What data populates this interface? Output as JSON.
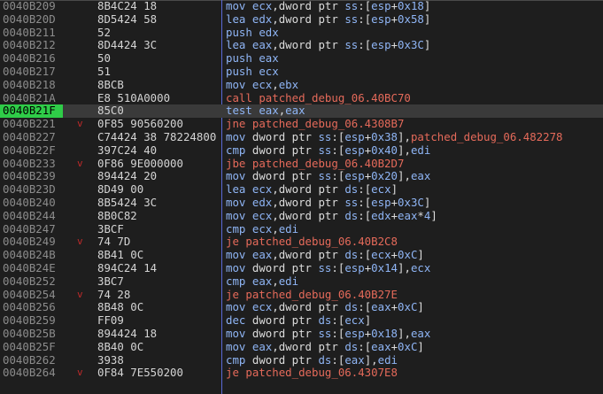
{
  "colors": {
    "background": "#1e1e1e",
    "current_address_bg": "#2fcc48",
    "separator": "#5a6ad8",
    "branch_mnemonic": "#e56a5a",
    "mnemonic": "#8fb5f5"
  },
  "rows": [
    {
      "addr": "0040B209",
      "bytes": "8B4C24 18",
      "mnem": "mov",
      "ops": [
        [
          "reg",
          "ecx"
        ],
        [
          "punc",
          ","
        ],
        [
          "ptr",
          "dword ptr "
        ],
        [
          "seg",
          "ss"
        ],
        [
          "punc",
          ":["
        ],
        [
          "reg",
          "esp"
        ],
        [
          "punc",
          "+"
        ],
        [
          "num",
          "0x18"
        ],
        [
          "punc",
          "]"
        ]
      ]
    },
    {
      "addr": "0040B20D",
      "bytes": "8D5424 58",
      "mnem": "lea",
      "ops": [
        [
          "reg",
          "edx"
        ],
        [
          "punc",
          ","
        ],
        [
          "ptr",
          "dword ptr "
        ],
        [
          "seg",
          "ss"
        ],
        [
          "punc",
          ":["
        ],
        [
          "reg",
          "esp"
        ],
        [
          "punc",
          "+"
        ],
        [
          "num",
          "0x58"
        ],
        [
          "punc",
          "]"
        ]
      ]
    },
    {
      "addr": "0040B211",
      "bytes": "52",
      "mnem": "push",
      "ops": [
        [
          "reg",
          "edx"
        ]
      ]
    },
    {
      "addr": "0040B212",
      "bytes": "8D4424 3C",
      "mnem": "lea",
      "ops": [
        [
          "reg",
          "eax"
        ],
        [
          "punc",
          ","
        ],
        [
          "ptr",
          "dword ptr "
        ],
        [
          "seg",
          "ss"
        ],
        [
          "punc",
          ":["
        ],
        [
          "reg",
          "esp"
        ],
        [
          "punc",
          "+"
        ],
        [
          "num",
          "0x3C"
        ],
        [
          "punc",
          "]"
        ]
      ]
    },
    {
      "addr": "0040B216",
      "bytes": "50",
      "mnem": "push",
      "ops": [
        [
          "reg",
          "eax"
        ]
      ]
    },
    {
      "addr": "0040B217",
      "bytes": "51",
      "mnem": "push",
      "ops": [
        [
          "reg",
          "ecx"
        ]
      ]
    },
    {
      "addr": "0040B218",
      "bytes": "8BCB",
      "mnem": "mov",
      "ops": [
        [
          "reg",
          "ecx"
        ],
        [
          "punc",
          ","
        ],
        [
          "reg",
          "ebx"
        ]
      ]
    },
    {
      "addr": "0040B21A",
      "bytes": "E8 510A0000",
      "mnem": "call",
      "jump": true,
      "ops": [
        [
          "sym",
          "patched_debug_06.40BC70"
        ]
      ]
    },
    {
      "addr": "0040B21F",
      "bytes": "85C0",
      "mnem": "test",
      "current": true,
      "ops": [
        [
          "reg",
          "eax"
        ],
        [
          "punc",
          ","
        ],
        [
          "reg",
          "eax"
        ]
      ]
    },
    {
      "addr": "0040B221",
      "bytes": "0F85 90560200",
      "mark": "v",
      "mnem": "jne",
      "jump": true,
      "ops": [
        [
          "sym",
          "patched_debug_06.4308B7"
        ]
      ]
    },
    {
      "addr": "0040B227",
      "bytes": "C74424 38 78224800",
      "mnem": "mov",
      "ops": [
        [
          "ptr",
          "dword ptr "
        ],
        [
          "seg",
          "ss"
        ],
        [
          "punc",
          ":["
        ],
        [
          "reg",
          "esp"
        ],
        [
          "punc",
          "+"
        ],
        [
          "num",
          "0x38"
        ],
        [
          "punc",
          "],"
        ],
        [
          "sym",
          "patched_debug_06.482278"
        ]
      ]
    },
    {
      "addr": "0040B22F",
      "bytes": "397C24 40",
      "mnem": "cmp",
      "ops": [
        [
          "ptr",
          "dword ptr "
        ],
        [
          "seg",
          "ss"
        ],
        [
          "punc",
          ":["
        ],
        [
          "reg",
          "esp"
        ],
        [
          "punc",
          "+"
        ],
        [
          "num",
          "0x40"
        ],
        [
          "punc",
          "],"
        ],
        [
          "reg",
          "edi"
        ]
      ]
    },
    {
      "addr": "0040B233",
      "bytes": "0F86 9E000000",
      "mark": "v",
      "mnem": "jbe",
      "jump": true,
      "ops": [
        [
          "sym",
          "patched_debug_06.40B2D7"
        ]
      ]
    },
    {
      "addr": "0040B239",
      "bytes": "894424 20",
      "mnem": "mov",
      "ops": [
        [
          "ptr",
          "dword ptr "
        ],
        [
          "seg",
          "ss"
        ],
        [
          "punc",
          ":["
        ],
        [
          "reg",
          "esp"
        ],
        [
          "punc",
          "+"
        ],
        [
          "num",
          "0x20"
        ],
        [
          "punc",
          "],"
        ],
        [
          "reg",
          "eax"
        ]
      ]
    },
    {
      "addr": "0040B23D",
      "bytes": "8D49 00",
      "mnem": "lea",
      "ops": [
        [
          "reg",
          "ecx"
        ],
        [
          "punc",
          ","
        ],
        [
          "ptr",
          "dword ptr "
        ],
        [
          "seg",
          "ds"
        ],
        [
          "punc",
          ":["
        ],
        [
          "reg",
          "ecx"
        ],
        [
          "punc",
          "]"
        ]
      ]
    },
    {
      "addr": "0040B240",
      "bytes": "8B5424 3C",
      "mnem": "mov",
      "ops": [
        [
          "reg",
          "edx"
        ],
        [
          "punc",
          ","
        ],
        [
          "ptr",
          "dword ptr "
        ],
        [
          "seg",
          "ss"
        ],
        [
          "punc",
          ":["
        ],
        [
          "reg",
          "esp"
        ],
        [
          "punc",
          "+"
        ],
        [
          "num",
          "0x3C"
        ],
        [
          "punc",
          "]"
        ]
      ]
    },
    {
      "addr": "0040B244",
      "bytes": "8B0C82",
      "mnem": "mov",
      "ops": [
        [
          "reg",
          "ecx"
        ],
        [
          "punc",
          ","
        ],
        [
          "ptr",
          "dword ptr "
        ],
        [
          "seg",
          "ds"
        ],
        [
          "punc",
          ":["
        ],
        [
          "reg",
          "edx"
        ],
        [
          "punc",
          "+"
        ],
        [
          "reg",
          "eax"
        ],
        [
          "punc",
          "*"
        ],
        [
          "num",
          "4"
        ],
        [
          "punc",
          "]"
        ]
      ]
    },
    {
      "addr": "0040B247",
      "bytes": "3BCF",
      "mnem": "cmp",
      "ops": [
        [
          "reg",
          "ecx"
        ],
        [
          "punc",
          ","
        ],
        [
          "reg",
          "edi"
        ]
      ]
    },
    {
      "addr": "0040B249",
      "bytes": "74 7D",
      "mark": "v",
      "mnem": "je",
      "jump": true,
      "ops": [
        [
          "sym",
          "patched_debug_06.40B2C8"
        ]
      ]
    },
    {
      "addr": "0040B24B",
      "bytes": "8B41 0C",
      "mnem": "mov",
      "ops": [
        [
          "reg",
          "eax"
        ],
        [
          "punc",
          ","
        ],
        [
          "ptr",
          "dword ptr "
        ],
        [
          "seg",
          "ds"
        ],
        [
          "punc",
          ":["
        ],
        [
          "reg",
          "ecx"
        ],
        [
          "punc",
          "+"
        ],
        [
          "num",
          "0xC"
        ],
        [
          "punc",
          "]"
        ]
      ]
    },
    {
      "addr": "0040B24E",
      "bytes": "894C24 14",
      "mnem": "mov",
      "ops": [
        [
          "ptr",
          "dword ptr "
        ],
        [
          "seg",
          "ss"
        ],
        [
          "punc",
          ":["
        ],
        [
          "reg",
          "esp"
        ],
        [
          "punc",
          "+"
        ],
        [
          "num",
          "0x14"
        ],
        [
          "punc",
          "],"
        ],
        [
          "reg",
          "ecx"
        ]
      ]
    },
    {
      "addr": "0040B252",
      "bytes": "3BC7",
      "mnem": "cmp",
      "ops": [
        [
          "reg",
          "eax"
        ],
        [
          "punc",
          ","
        ],
        [
          "reg",
          "edi"
        ]
      ]
    },
    {
      "addr": "0040B254",
      "bytes": "74 28",
      "mark": "v",
      "mnem": "je",
      "jump": true,
      "ops": [
        [
          "sym",
          "patched_debug_06.40B27E"
        ]
      ]
    },
    {
      "addr": "0040B256",
      "bytes": "8B48 0C",
      "mnem": "mov",
      "ops": [
        [
          "reg",
          "ecx"
        ],
        [
          "punc",
          ","
        ],
        [
          "ptr",
          "dword ptr "
        ],
        [
          "seg",
          "ds"
        ],
        [
          "punc",
          ":["
        ],
        [
          "reg",
          "eax"
        ],
        [
          "punc",
          "+"
        ],
        [
          "num",
          "0xC"
        ],
        [
          "punc",
          "]"
        ]
      ]
    },
    {
      "addr": "0040B259",
      "bytes": "FF09",
      "mnem": "dec",
      "ops": [
        [
          "ptr",
          "dword ptr "
        ],
        [
          "seg",
          "ds"
        ],
        [
          "punc",
          ":["
        ],
        [
          "reg",
          "ecx"
        ],
        [
          "punc",
          "]"
        ]
      ]
    },
    {
      "addr": "0040B25B",
      "bytes": "894424 18",
      "mnem": "mov",
      "ops": [
        [
          "ptr",
          "dword ptr "
        ],
        [
          "seg",
          "ss"
        ],
        [
          "punc",
          ":["
        ],
        [
          "reg",
          "esp"
        ],
        [
          "punc",
          "+"
        ],
        [
          "num",
          "0x18"
        ],
        [
          "punc",
          "],"
        ],
        [
          "reg",
          "eax"
        ]
      ]
    },
    {
      "addr": "0040B25F",
      "bytes": "8B40 0C",
      "mnem": "mov",
      "ops": [
        [
          "reg",
          "eax"
        ],
        [
          "punc",
          ","
        ],
        [
          "ptr",
          "dword ptr "
        ],
        [
          "seg",
          "ds"
        ],
        [
          "punc",
          ":["
        ],
        [
          "reg",
          "eax"
        ],
        [
          "punc",
          "+"
        ],
        [
          "num",
          "0xC"
        ],
        [
          "punc",
          "]"
        ]
      ]
    },
    {
      "addr": "0040B262",
      "bytes": "3938",
      "mnem": "cmp",
      "ops": [
        [
          "ptr",
          "dword ptr "
        ],
        [
          "seg",
          "ds"
        ],
        [
          "punc",
          ":["
        ],
        [
          "reg",
          "eax"
        ],
        [
          "punc",
          "],"
        ],
        [
          "reg",
          "edi"
        ]
      ]
    },
    {
      "addr": "0040B264",
      "bytes": "0F84 7E550200",
      "mark": "v",
      "mnem": "je",
      "jump": true,
      "ops": [
        [
          "sym",
          "patched_debug_06.4307E8"
        ]
      ]
    }
  ]
}
